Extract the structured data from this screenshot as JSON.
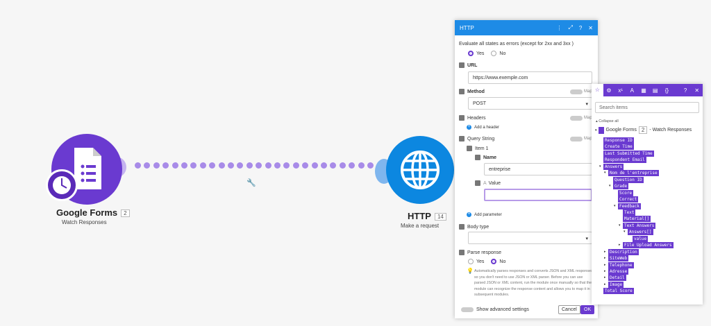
{
  "colors": {
    "accent_purple": "#6a3ad0",
    "http_blue": "#0c87e0",
    "panel_header": "#1e8be6"
  },
  "nodes": {
    "google_forms": {
      "title": "Google Forms",
      "badge": "2",
      "subtitle": "Watch Responses",
      "icon": "google-forms-icon"
    },
    "http": {
      "title": "HTTP",
      "badge": "14",
      "subtitle": "Make a request",
      "icon": "globe-icon"
    }
  },
  "http_panel": {
    "title": "HTTP",
    "evaluate_label": "Evaluate all states as errors (except for 2xx and 3xx )",
    "evaluate_yes": "Yes",
    "evaluate_no": "No",
    "url_label": "URL",
    "url_value": "https://www.exemple.com",
    "method_label": "Method",
    "method_value": "POST",
    "map_label": "Map",
    "headers_label": "Headers",
    "add_header": "Add a header",
    "query_label": "Query String",
    "item_label": "Item 1",
    "name_label": "Name",
    "name_value": "entreprise",
    "value_label": "Value",
    "value_prefix": "A",
    "add_parameter": "Add parameter",
    "body_type_label": "Body type",
    "parse_label": "Parse response",
    "parse_yes": "Yes",
    "parse_no": "No",
    "help_text": "Automatically parses responses and converts JSON and XML responses so you don't need to use JSON or XML parser. Before you can use parsed JSON or XML content, run the module once manually so that the module can recognize the response content and allows you to map it in subsequent modules.",
    "advanced_label": "Show advanced settings",
    "cancel": "Cancel",
    "ok": "OK"
  },
  "mapping_panel": {
    "tabs": [
      "star-icon",
      "gear-icon",
      "superscript-icon",
      "text-icon",
      "calendar-icon",
      "table-icon",
      "braces-icon"
    ],
    "search_placeholder": "Search items",
    "collapse_all": "Collapse all",
    "module_name": "Google Forms",
    "module_badge": "2",
    "module_sub": "- Watch Responses",
    "items": [
      {
        "label": "Response ID"
      },
      {
        "label": "Create Time"
      },
      {
        "label": "Last Submitted Time"
      },
      {
        "label": "Respondent Email"
      },
      {
        "label": "Answers"
      },
      {
        "label": "Nom de l'entreprise"
      },
      {
        "label": "Question ID"
      },
      {
        "label": "Grade"
      },
      {
        "label": "Score"
      },
      {
        "label": "Correct"
      },
      {
        "label": "Feedback"
      },
      {
        "label": "Text"
      },
      {
        "label": "Material[]"
      },
      {
        "label": "Text Answers"
      },
      {
        "label": "Answers[]"
      },
      {
        "label": "value"
      },
      {
        "label": "File Upload Answers"
      },
      {
        "label": "Description"
      },
      {
        "label": "SiteWeb"
      },
      {
        "label": "Telephone"
      },
      {
        "label": "Adresse"
      },
      {
        "label": "Detail"
      },
      {
        "label": "Image"
      },
      {
        "label": "Total Score"
      }
    ]
  }
}
